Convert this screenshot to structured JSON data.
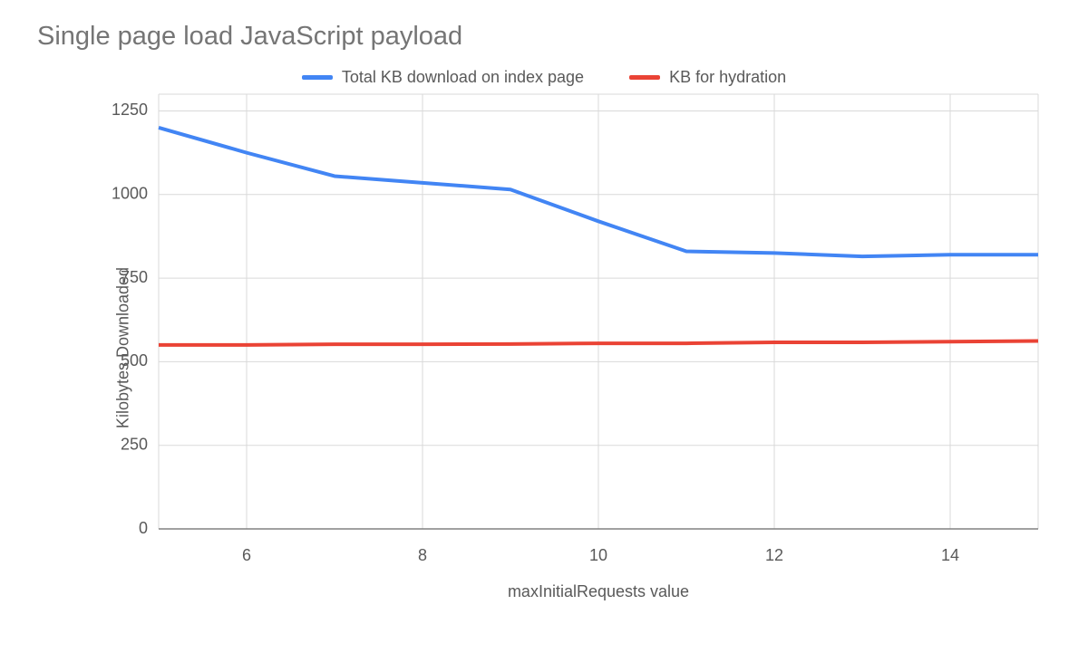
{
  "title": "Single page load JavaScript payload",
  "legend": {
    "series1": "Total KB download on index page",
    "series2": "KB for hydration"
  },
  "xlabel": "maxInitialRequests value",
  "ylabel": "Kilobytes Downloaded",
  "chart_data": {
    "type": "line",
    "x": [
      5,
      6,
      7,
      8,
      9,
      10,
      11,
      12,
      13,
      14,
      15
    ],
    "x_ticks": [
      6,
      8,
      10,
      12,
      14
    ],
    "y_ticks": [
      0,
      250,
      500,
      750,
      1000,
      1250
    ],
    "xlim": [
      5,
      15
    ],
    "ylim": [
      0,
      1300
    ],
    "series": [
      {
        "name": "Total KB download on index page",
        "color": "#4285f4",
        "values": [
          1200,
          1125,
          1055,
          1035,
          1015,
          920,
          830,
          825,
          815,
          820,
          820
        ]
      },
      {
        "name": "KB for hydration",
        "color": "#ea4335",
        "values": [
          550,
          550,
          552,
          552,
          553,
          555,
          555,
          558,
          558,
          560,
          562
        ]
      }
    ],
    "title": "Single page load JavaScript payload",
    "xlabel": "maxInitialRequests value",
    "ylabel": "Kilobytes Downloaded"
  }
}
